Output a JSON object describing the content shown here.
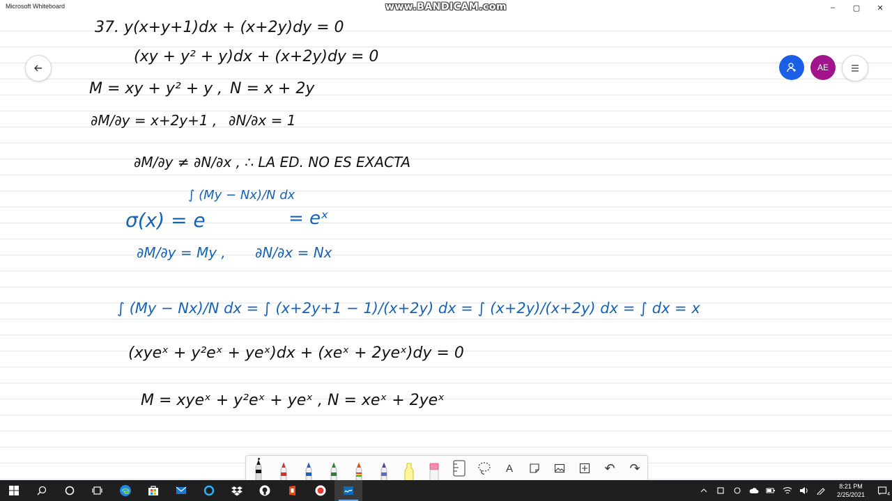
{
  "window": {
    "title": "Microsoft Whiteboard",
    "watermark": "www.BANDICAM.com",
    "controls": {
      "minimize": "–",
      "maximize": "▢",
      "close": "✕"
    }
  },
  "top_bar": {
    "avatar_initials": "AE"
  },
  "whiteboard": {
    "lines": [
      {
        "text": "37.  y(x+y+1)dx + (x+2y)dy = 0",
        "color": "#111111"
      },
      {
        "text": "(xy + y² + y)dx + (x+2y)dy = 0",
        "color": "#111111"
      },
      {
        "text": "M = xy + y² + y ,",
        "color": "#111111"
      },
      {
        "text": "N = x + 2y",
        "color": "#111111"
      },
      {
        "text": "∂M/∂y = x+2y+1 ,",
        "color": "#111111"
      },
      {
        "text": "∂N/∂x = 1",
        "color": "#111111"
      },
      {
        "text": "∂M/∂y ≠ ∂N/∂x ,  ∴  LA ED.  NO ES  EXACTA",
        "color": "#111111"
      },
      {
        "text": "σ(x) = e",
        "color": "#1463b8"
      },
      {
        "text": "∫ (My − Nx)/N dx",
        "color": "#1463b8"
      },
      {
        "text": "= eˣ",
        "color": "#1463b8"
      },
      {
        "text": "∂M/∂y = My ,",
        "color": "#1463b8"
      },
      {
        "text": "∂N/∂x = Nx",
        "color": "#1463b8"
      },
      {
        "text": "∫ (My − Nx)/N dx = ∫ (x+2y+1 − 1)/(x+2y) dx = ∫ (x+2y)/(x+2y) dx = ∫ dx = x",
        "color": "#1463b8"
      },
      {
        "text": "(xyeˣ + y²eˣ + yeˣ)dx + (xeˣ + 2yeˣ)dy = 0",
        "color": "#111111"
      },
      {
        "text": "M = xyeˣ + y²eˣ + yeˣ  ,  N = xeˣ + 2yeˣ",
        "color": "#111111"
      }
    ]
  },
  "toolbar": {
    "tools": [
      {
        "name": "pen-black-tool",
        "icon": "pen-icon",
        "color": "#111111",
        "active": true
      },
      {
        "name": "pen-red-tool",
        "icon": "pen-icon",
        "color": "#d32f2f",
        "active": false
      },
      {
        "name": "pen-blue-tool",
        "icon": "pen-icon",
        "color": "#1565c0",
        "active": false
      },
      {
        "name": "pen-green-tool",
        "icon": "pen-icon",
        "color": "#2e7d32",
        "active": false
      },
      {
        "name": "pen-rainbow-tool",
        "icon": "pen-icon",
        "color": "#e65100",
        "active": false
      },
      {
        "name": "pen-galaxy-tool",
        "icon": "pen-icon",
        "color": "#3949ab",
        "active": false
      },
      {
        "name": "highlighter-yellow-tool",
        "icon": "highlighter-icon",
        "color": "#fdd835",
        "active": false
      },
      {
        "name": "highlighter-pink-tool",
        "icon": "highlighter-icon",
        "color": "#f48fb1",
        "active": false
      },
      {
        "name": "ruler-tool",
        "icon": "ruler-icon",
        "color": "#333333",
        "active": false
      },
      {
        "name": "lasso-tool",
        "icon": "lasso-icon",
        "color": "#333333",
        "active": false
      }
    ],
    "text_tool_glyph": "A",
    "undo_glyph": "↶",
    "redo_glyph": "↷"
  },
  "taskbar": {
    "clock_time": "8:21 PM",
    "clock_date": "2/25/2021",
    "notification_count": "4"
  }
}
